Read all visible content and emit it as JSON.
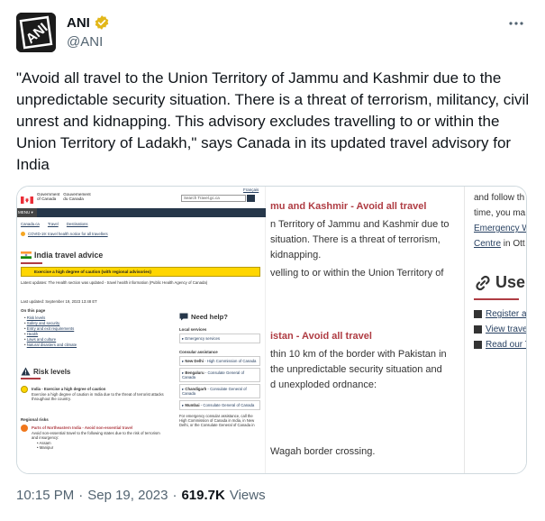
{
  "author": {
    "display_name": "ANI",
    "handle": "@ANI",
    "avatar_text": "ANI"
  },
  "tweet_text": "\"Avoid all travel to the Union Territory of Jammu and Kashmir due to the unpredictable security situation. There is a threat of terrorism, militancy, civil unrest and kidnapping. This advisory excludes travelling to or within the Union Territory of Ladakh,\" says Canada in its updated travel advisory for India",
  "footer": {
    "time": "10:15 PM",
    "sep1": "·",
    "date": "Sep 19, 2023",
    "sep2": "·",
    "views": "619.7K",
    "views_label": "Views"
  },
  "screenshot": {
    "left": {
      "gov_en_1": "Government",
      "gov_en_2": "of Canada",
      "gov_fr_1": "Gouvernement",
      "gov_fr_2": "du Canada",
      "lang": "Français",
      "search_placeholder": "Search Travel.gc.ca",
      "menu_label": "MENU ▾",
      "breadcrumbs": [
        "Canada.ca",
        "Travel",
        "Destinations"
      ],
      "covid_link": "COVID-19: travel health notice for all travellers",
      "title": "India travel advice",
      "banner": "Exercise a high degree of caution (with regional advisories)",
      "latest_updates": "Latest updates: The Health section was updated - travel health information (Public Health Agency of Canada)",
      "last_updated": "Last updated: September 19, 2023 13:48 ET",
      "on_this_page": "On this page",
      "toc": [
        "Risk levels",
        "Safety and security",
        "Entry and exit requirements",
        "Health",
        "Laws and culture",
        "Natural disasters and climate"
      ],
      "risk_title": "Risk levels",
      "risk_india_title": "India - Exercise a high degree of caution",
      "risk_india_body": "Exercise a high degree of caution in India due to the threat of terrorist attacks throughout the country.",
      "regional_risks": "Regional risks",
      "risk_ne_title": "Parts of Northeastern India - Avoid non-essential travel",
      "risk_ne_body": "Avoid non-essential travel to the following states due to the risk of terrorism and insurgency:",
      "risk_ne_states": [
        "Assam",
        "Manipur"
      ],
      "help": {
        "title": "Need help?",
        "local_services": "Local services",
        "emergency_services": "Emergency services",
        "consular_assistance": "Consular assistance",
        "offices": [
          {
            "city": "New Delhi",
            "type": "High Commission of Canada"
          },
          {
            "city": "Bengaluru",
            "type": "Consulate General of Canada"
          },
          {
            "city": "Chandigarh",
            "type": "Consulate General of Canada"
          },
          {
            "city": "Mumbai",
            "type": "Consulate General of Canada"
          }
        ],
        "footer": "For emergency consular assistance, call the High Commission of Canada in India, in New Delhi, or the Consulate General of Canada in"
      }
    },
    "middle": {
      "heading1": "mu and Kashmir - Avoid all travel",
      "p1_l1": "n Territory of Jammu and Kashmir due to",
      "p1_l2": "situation. There is a threat of terrorism,",
      "p1_l3": "kidnapping.",
      "p1_l4": "velling to or within the Union Territory of",
      "heading2": "istan - Avoid all travel",
      "p2_l1": "thin 10 km of the border with Pakistan in",
      "p2_l2": "the unpredictable security situation and",
      "p2_l3": "d unexploded ordnance:",
      "p2_l4": "Wagah border crossing."
    },
    "right": {
      "l1": "and follow th",
      "l2": "time, you ma",
      "l3": "Emergency W",
      "l4_link": "Centre",
      "l4_rest": " in Ott",
      "use_title": "Use",
      "items": [
        "Register as a",
        "View travel",
        "Read our Tr"
      ]
    }
  },
  "colors": {
    "accent_red": "#af3c43",
    "gc_navy": "#26374a",
    "link": "#284162",
    "banner_yellow": "#ffd600",
    "verified_gold": "#e2b719"
  }
}
